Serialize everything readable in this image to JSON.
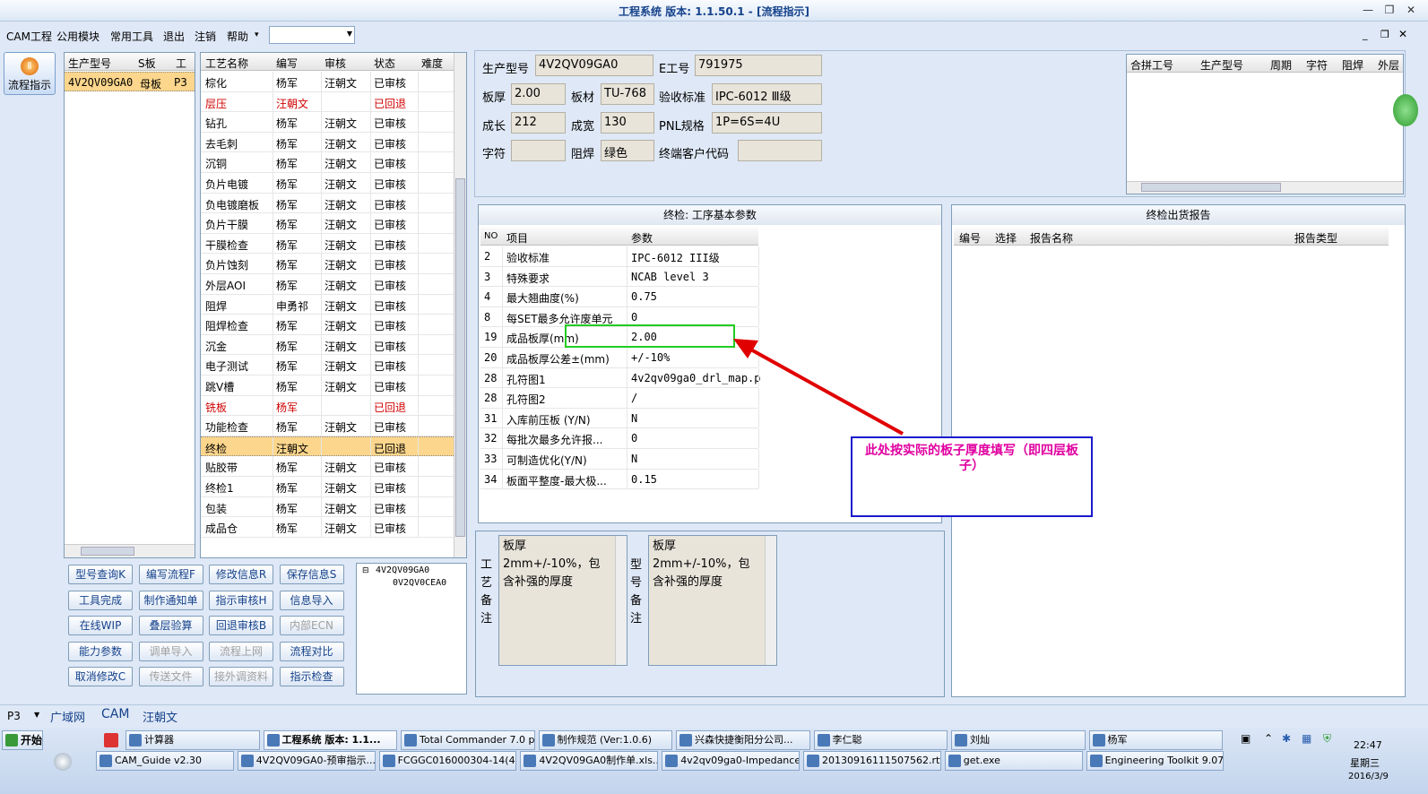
{
  "window": {
    "title": "工程系统  版本: 1.1.50.1 - [流程指示]"
  },
  "menu": {
    "items": [
      "CAM工程",
      "公用模块",
      "常用工具",
      "退出",
      "注销",
      "帮助"
    ],
    "help_arrow": "▾",
    "combo_value": ""
  },
  "side": {
    "flow_label": "流程指示"
  },
  "part_grid": {
    "headers": [
      "生产型号",
      "S板",
      "工厂"
    ],
    "rows": [
      {
        "model": "4V2QV09GA0",
        "board": "母板",
        "factory": "P3"
      }
    ]
  },
  "process_grid": {
    "headers": [
      "工艺名称",
      "编写",
      "审核",
      "状态",
      "难度"
    ],
    "rows": [
      {
        "name": "棕化",
        "writer": "杨军",
        "reviewer": "汪朝文",
        "status": "已审核",
        "red": false
      },
      {
        "name": "层压",
        "writer": "汪朝文",
        "reviewer": "",
        "status": "已回退",
        "red": true
      },
      {
        "name": "钻孔",
        "writer": "杨军",
        "reviewer": "汪朝文",
        "status": "已审核",
        "red": false
      },
      {
        "name": "去毛刺",
        "writer": "杨军",
        "reviewer": "汪朝文",
        "status": "已审核",
        "red": false
      },
      {
        "name": "沉铜",
        "writer": "杨军",
        "reviewer": "汪朝文",
        "status": "已审核",
        "red": false
      },
      {
        "name": "负片电镀",
        "writer": "杨军",
        "reviewer": "汪朝文",
        "status": "已审核",
        "red": false
      },
      {
        "name": "负电镀磨板",
        "writer": "杨军",
        "reviewer": "汪朝文",
        "status": "已审核",
        "red": false
      },
      {
        "name": "负片干膜",
        "writer": "杨军",
        "reviewer": "汪朝文",
        "status": "已审核",
        "red": false
      },
      {
        "name": "干膜检查",
        "writer": "杨军",
        "reviewer": "汪朝文",
        "status": "已审核",
        "red": false
      },
      {
        "name": "负片蚀刻",
        "writer": "杨军",
        "reviewer": "汪朝文",
        "status": "已审核",
        "red": false
      },
      {
        "name": "外层AOI",
        "writer": "杨军",
        "reviewer": "汪朝文",
        "status": "已审核",
        "red": false
      },
      {
        "name": "阻焊",
        "writer": "申勇祁",
        "reviewer": "汪朝文",
        "status": "已审核",
        "red": false
      },
      {
        "name": "阻焊检查",
        "writer": "杨军",
        "reviewer": "汪朝文",
        "status": "已审核",
        "red": false
      },
      {
        "name": "沉金",
        "writer": "杨军",
        "reviewer": "汪朝文",
        "status": "已审核",
        "red": false
      },
      {
        "name": "电子测试",
        "writer": "杨军",
        "reviewer": "汪朝文",
        "status": "已审核",
        "red": false
      },
      {
        "name": "跳V槽",
        "writer": "杨军",
        "reviewer": "汪朝文",
        "status": "已审核",
        "red": false
      },
      {
        "name": "铣板",
        "writer": "杨军",
        "reviewer": "",
        "status": "已回退",
        "red": true
      },
      {
        "name": "功能检查",
        "writer": "杨军",
        "reviewer": "汪朝文",
        "status": "已审核",
        "red": false
      },
      {
        "name": "终检",
        "writer": "汪朝文",
        "reviewer": "",
        "status": "已回退",
        "red": false,
        "selected": true
      },
      {
        "name": "贴胶带",
        "writer": "杨军",
        "reviewer": "汪朝文",
        "status": "已审核",
        "red": false
      },
      {
        "name": "终检1",
        "writer": "杨军",
        "reviewer": "汪朝文",
        "status": "已审核",
        "red": false
      },
      {
        "name": "包装",
        "writer": "杨军",
        "reviewer": "汪朝文",
        "status": "已审核",
        "red": false
      },
      {
        "name": "成品仓",
        "writer": "杨军",
        "reviewer": "汪朝文",
        "status": "已审核",
        "red": false
      }
    ]
  },
  "buttons": [
    {
      "label": "型号查询K",
      "disabled": false
    },
    {
      "label": "编写流程F",
      "disabled": false
    },
    {
      "label": "修改信息R",
      "disabled": false
    },
    {
      "label": "保存信息S",
      "disabled": false
    },
    {
      "label": "工具完成",
      "disabled": false
    },
    {
      "label": "制作通知单",
      "disabled": false
    },
    {
      "label": "指示审核H",
      "disabled": false
    },
    {
      "label": "信息导入",
      "disabled": false
    },
    {
      "label": "在线WIP",
      "disabled": false
    },
    {
      "label": "叠层验算",
      "disabled": false
    },
    {
      "label": "回退审核B",
      "disabled": false
    },
    {
      "label": "内部ECN",
      "disabled": true
    },
    {
      "label": "能力参数",
      "disabled": false
    },
    {
      "label": "调单导入",
      "disabled": true
    },
    {
      "label": "流程上网",
      "disabled": true
    },
    {
      "label": "流程对比",
      "disabled": false
    },
    {
      "label": "取消修改C",
      "disabled": false
    },
    {
      "label": "传送文件",
      "disabled": true
    },
    {
      "label": "接外调资料",
      "disabled": true
    },
    {
      "label": "指示检查",
      "disabled": false
    }
  ],
  "tree": {
    "root": "4V2QV09GA0",
    "child": "0V2QV0CEA0"
  },
  "info": {
    "model_label": "生产型号",
    "model_value": "4V2QV09GA0",
    "eno_label": "E工号",
    "eno_value": "791975",
    "thick_label": "板厚",
    "thick_value": "2.00",
    "material_label": "板材",
    "material_value": "TU-768",
    "std_label": "验收标准",
    "std_value": "IPC-6012 Ⅲ级",
    "len_label": "成长",
    "len_value": "212",
    "width_label": "成宽",
    "width_value": "130",
    "pnl_label": "PNL规格",
    "pnl_value": "1P=6S=4U",
    "char_label": "字符",
    "char_value": "",
    "mask_label": "阻焊",
    "mask_value": "绿色",
    "customer_label": "终端客户代码",
    "customer_value": ""
  },
  "merge_grid": {
    "headers": [
      "合拼工号",
      "生产型号",
      "周期",
      "字符",
      "阻焊",
      "外层"
    ]
  },
  "params": {
    "title": "终检: 工序基本参数",
    "headers": [
      "NO",
      "项目",
      "参数"
    ],
    "rows": [
      {
        "no": "2",
        "item": "验收标准",
        "value": "IPC-6012 III级"
      },
      {
        "no": "3",
        "item": "特殊要求",
        "value": "NCAB level 3"
      },
      {
        "no": "4",
        "item": "最大翘曲度(%)",
        "value": "0.75"
      },
      {
        "no": "8",
        "item": "每SET最多允许废单元",
        "value": "0"
      },
      {
        "no": "19",
        "item": "成品板厚(mm)",
        "value": "2.00"
      },
      {
        "no": "20",
        "item": "成品板厚公差±(mm)",
        "value": "+/-10%"
      },
      {
        "no": "28",
        "item": "孔符图1",
        "value": "4v2qv09ga0_drl_map.p"
      },
      {
        "no": "28",
        "item": "孔符图2",
        "value": "/"
      },
      {
        "no": "31",
        "item": "入库前压板 (Y/N)",
        "value": "N"
      },
      {
        "no": "32",
        "item": "每批次最多允许报...",
        "value": "0"
      },
      {
        "no": "33",
        "item": "可制造优化(Y/N)",
        "value": "N"
      },
      {
        "no": "34",
        "item": "板面平整度-最大极...",
        "value": "0.15"
      }
    ]
  },
  "report": {
    "title": "终检出货报告",
    "headers": [
      "编号",
      "选择",
      "报告名称",
      "报告类型"
    ]
  },
  "annotation": {
    "text": "此处按实际的板子厚度填写（即四层板子）"
  },
  "notes": {
    "process_label": "工艺备注",
    "process_text": "板厚2mm+/-10%，包含补强的厚度",
    "model_label": "型号备注",
    "model_text": "板厚2mm+/-10%，包含补强的厚度"
  },
  "status": {
    "factory": "P3",
    "net": "广域网",
    "module": "CAM",
    "user": "汪朝文"
  },
  "taskbar": {
    "start": "开始",
    "row1": [
      "计算器",
      "工程系统  版本: 1.1...",
      "Total Commander 7.0 p...",
      "制作规范 (Ver:1.0.6)",
      "兴森快捷衡阳分公司...",
      "李仁聪",
      "刘灿",
      "杨军"
    ],
    "row2": [
      "CAM_Guide v2.30",
      "4V2QV09GA0-预审指示...",
      "FCGGC016000304-14(4...",
      "4V2QV09GA0制作单.xls...",
      "4v2qv09ga0-Impedance...",
      "20130916111507562.rtf...",
      "get.exe",
      "Engineering Toolkit 9.07..."
    ],
    "clock": "22:47",
    "weekday": "星期三",
    "date": "2016/3/9"
  },
  "colors": {
    "accent": "#15428b",
    "annotation_box": "#1a1acc",
    "annotation_text": "#e000a0",
    "arrow": "#e00000",
    "highlight": "#22cc22"
  }
}
